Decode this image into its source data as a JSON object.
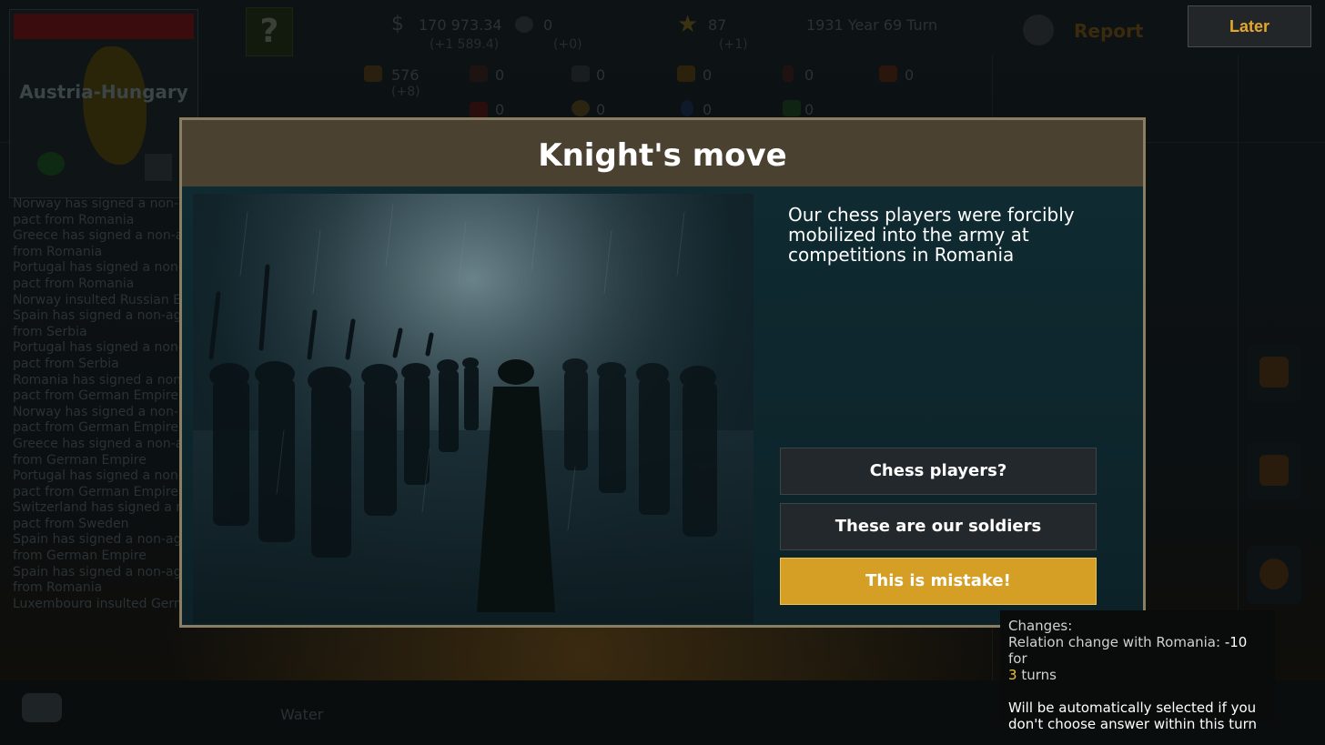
{
  "top_bar": {
    "money": "170 973.34",
    "money_delta": "(+1 589.4)",
    "science": "0",
    "science_delta": "(+0)",
    "stars": "87",
    "stars_delta": "(+1)",
    "date": "1931 Year 69 Turn",
    "help_icon": "?",
    "report_label": "Report",
    "later_label": "Later"
  },
  "resources": [
    {
      "icon": "wood-icon",
      "value": "576",
      "delta": "(+8)"
    },
    {
      "icon": "cotton-icon",
      "value": "0"
    },
    {
      "icon": "iron-icon",
      "value": "0"
    },
    {
      "icon": "gold-icon",
      "value": "0"
    },
    {
      "icon": "oil-icon",
      "value": "0"
    },
    {
      "icon": "ammo-icon",
      "value": "0"
    },
    {
      "icon": "meat-icon",
      "value": "0"
    },
    {
      "icon": "radiation-icon",
      "value": "0"
    },
    {
      "icon": "water-drop-icon",
      "value": "0"
    },
    {
      "icon": "plant-icon",
      "value": "0"
    }
  ],
  "country": {
    "name": "Austria-Hungary"
  },
  "news_feed": [
    "Norway has signed a non-a",
    "pact from Romania",
    "Greece has signed a non-ag",
    "from Romania",
    "Portugal has signed a non-",
    "pact from Romania",
    "Norway insulted Russian E",
    "Spain has signed a non-ag",
    "from Serbia",
    "Portugal has signed a non-",
    "pact from Serbia",
    "Romania has signed a non-",
    "pact from German Empire",
    "Norway has signed a non-",
    "pact from German Empire",
    "Greece has signed a non-a",
    "from German Empire",
    "Portugal has signed a non-",
    "pact from German Empire",
    "Switzerland has signed a n",
    "pact from Sweden",
    "Spain has signed a non-ag",
    "from German Empire",
    "Spain has signed a non-ag",
    "from Romania",
    "Luxembourg insulted Germ"
  ],
  "map_label": "Water",
  "event": {
    "title": "Knight's move",
    "description": "Our chess players were forcibly mobilized into the army at competitions in Romania",
    "choices": [
      {
        "label": "Chess players?"
      },
      {
        "label": "These are our soldiers"
      },
      {
        "label": "This is mistake!"
      }
    ]
  },
  "tooltip": {
    "heading": "Changes:",
    "relation_text": "Relation change with Romania:",
    "relation_value": "-10",
    "for_text": "for",
    "turns_value": "3",
    "turns_text": "turns",
    "auto_note": "Will be automatically selected if you don't choose answer within this turn"
  },
  "colors": {
    "accent": "#d59e24",
    "header": "#4b4131",
    "modal_bg": "#0c1e24",
    "later_text": "#e3a72b"
  }
}
